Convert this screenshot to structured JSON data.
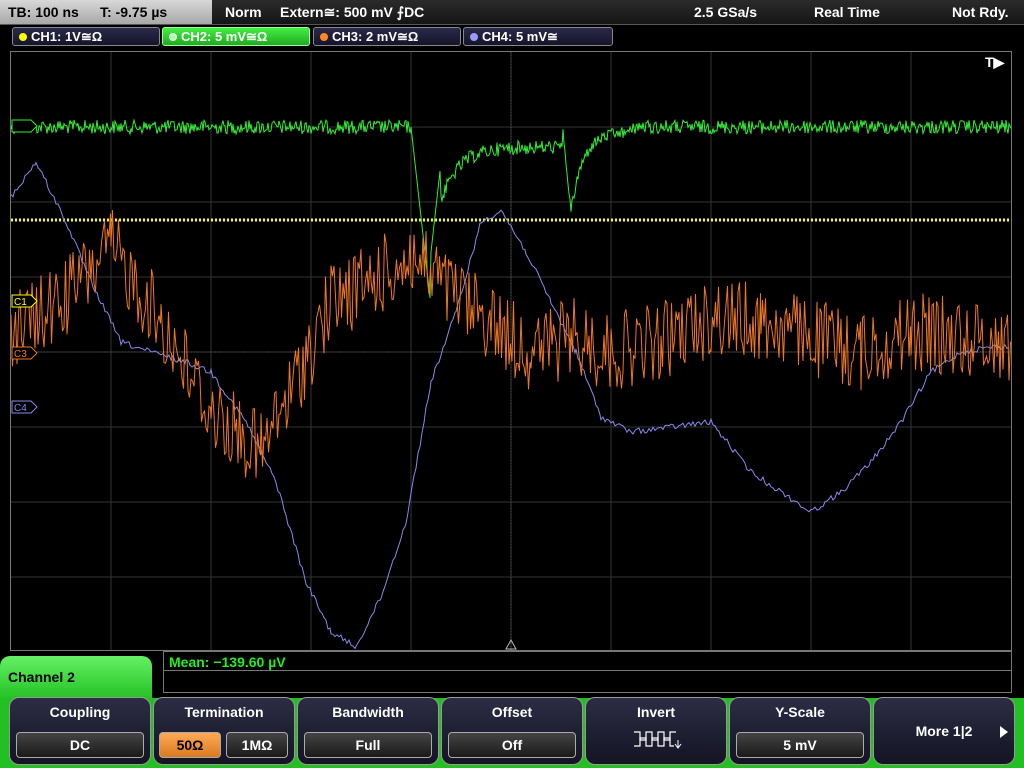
{
  "topbar": {
    "timebase": "TB: 100 ns",
    "trigger_time": "T: -9.75 µs",
    "mode": "Norm",
    "trigger_source": "Extern≅: 500 mV ⨍DC",
    "sample_rate": "2.5 GSa/s",
    "acq_mode": "Real Time",
    "status": "Not Rdy."
  },
  "channels": [
    {
      "label": "CH1: 1V≅Ω",
      "color": "#ffff00"
    },
    {
      "label": "CH2: 5 mV≅Ω",
      "color": "#33ee33"
    },
    {
      "label": "CH3: 2 mV≅Ω",
      "color": "#ff8822"
    },
    {
      "label": "CH4: 5 mV≅",
      "color": "#9999ff"
    }
  ],
  "markers": {
    "c1": "C1",
    "c3": "C3",
    "c4": "C4",
    "trigger": "T▶"
  },
  "measurement": {
    "text": "Mean: −139.60 µV"
  },
  "panel": {
    "title": "Channel 2"
  },
  "softkeys": {
    "coupling": {
      "label": "Coupling",
      "value": "DC"
    },
    "termination": {
      "label": "Termination",
      "opt1": "50Ω",
      "opt2": "1MΩ"
    },
    "bandwidth": {
      "label": "Bandwidth",
      "value": "Full"
    },
    "offset": {
      "label": "Offset",
      "value": "Off"
    },
    "invert": {
      "label": "Invert"
    },
    "yscale": {
      "label": "Y-Scale",
      "value": "5 mV"
    },
    "more": {
      "label": "More 1|2"
    }
  }
}
